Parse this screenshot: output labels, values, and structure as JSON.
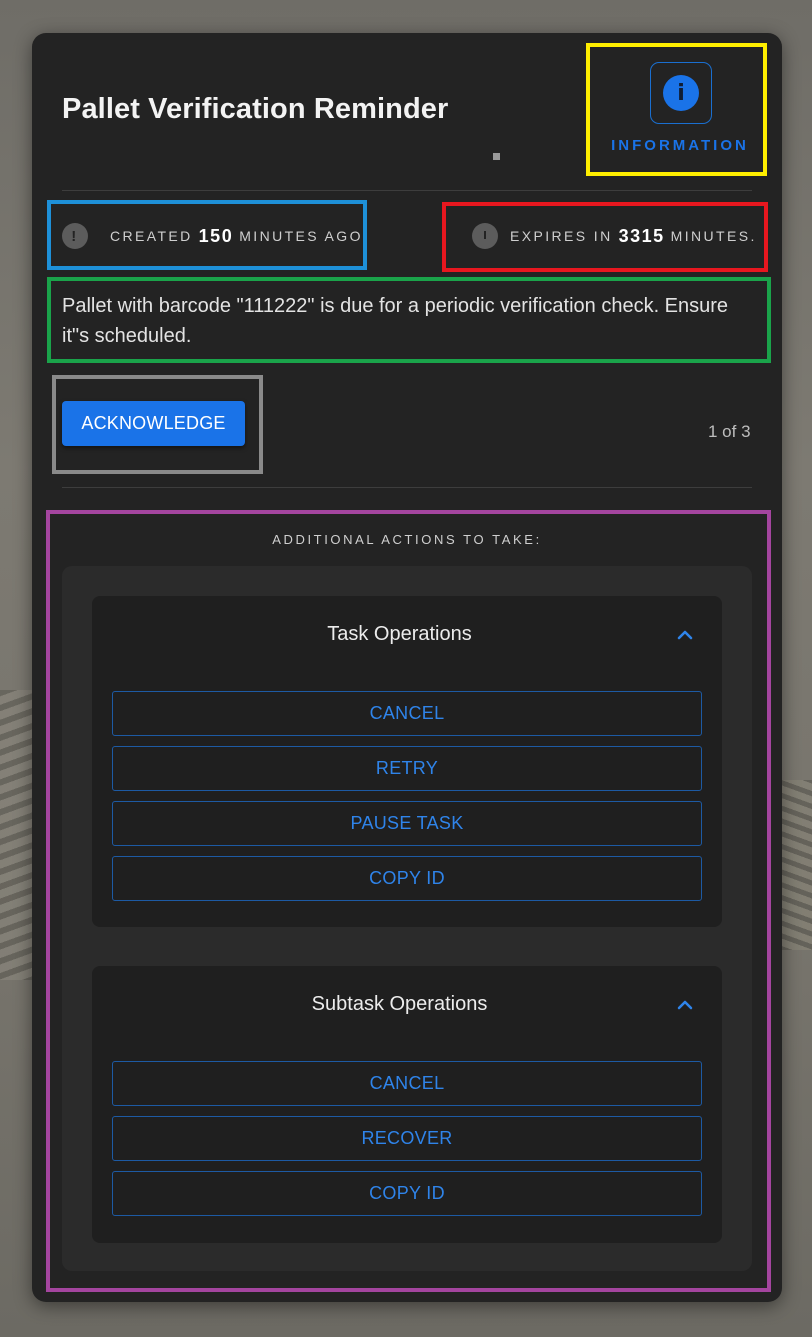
{
  "notification": {
    "title": "Pallet Verification Reminder",
    "info_label": "INFORMATION",
    "created": {
      "prefix": "CREATED",
      "value": "150",
      "suffix": "MINUTES AGO."
    },
    "expires": {
      "prefix": "EXPIRES IN",
      "value": "3315",
      "suffix": "MINUTES."
    },
    "message": "Pallet with barcode \"111222\" is due for a periodic verification check. Ensure it\"s scheduled.",
    "acknowledge_label": "ACKNOWLEDGE",
    "pager": "1 of 3"
  },
  "actions": {
    "title": "ADDITIONAL ACTIONS TO TAKE:",
    "groups": [
      {
        "title": "Task Operations",
        "buttons": [
          "CANCEL",
          "RETRY",
          "PAUSE TASK",
          "COPY ID"
        ]
      },
      {
        "title": "Subtask Operations",
        "buttons": [
          "CANCEL",
          "RECOVER",
          "COPY ID"
        ]
      }
    ]
  },
  "colors": {
    "card": "#232323",
    "accent": "#1a73e8",
    "highlight_info": "#ffee00",
    "highlight_created": "#1e90d8",
    "highlight_expires": "#e8171f",
    "highlight_message": "#1aa34a",
    "highlight_acknowledge": "#8a8a8a",
    "highlight_actions": "#a4459f"
  },
  "icons": {
    "info": "info-icon",
    "created": "alert-badge-icon",
    "expires": "stopwatch-icon",
    "collapse": "chevron-up-icon"
  }
}
